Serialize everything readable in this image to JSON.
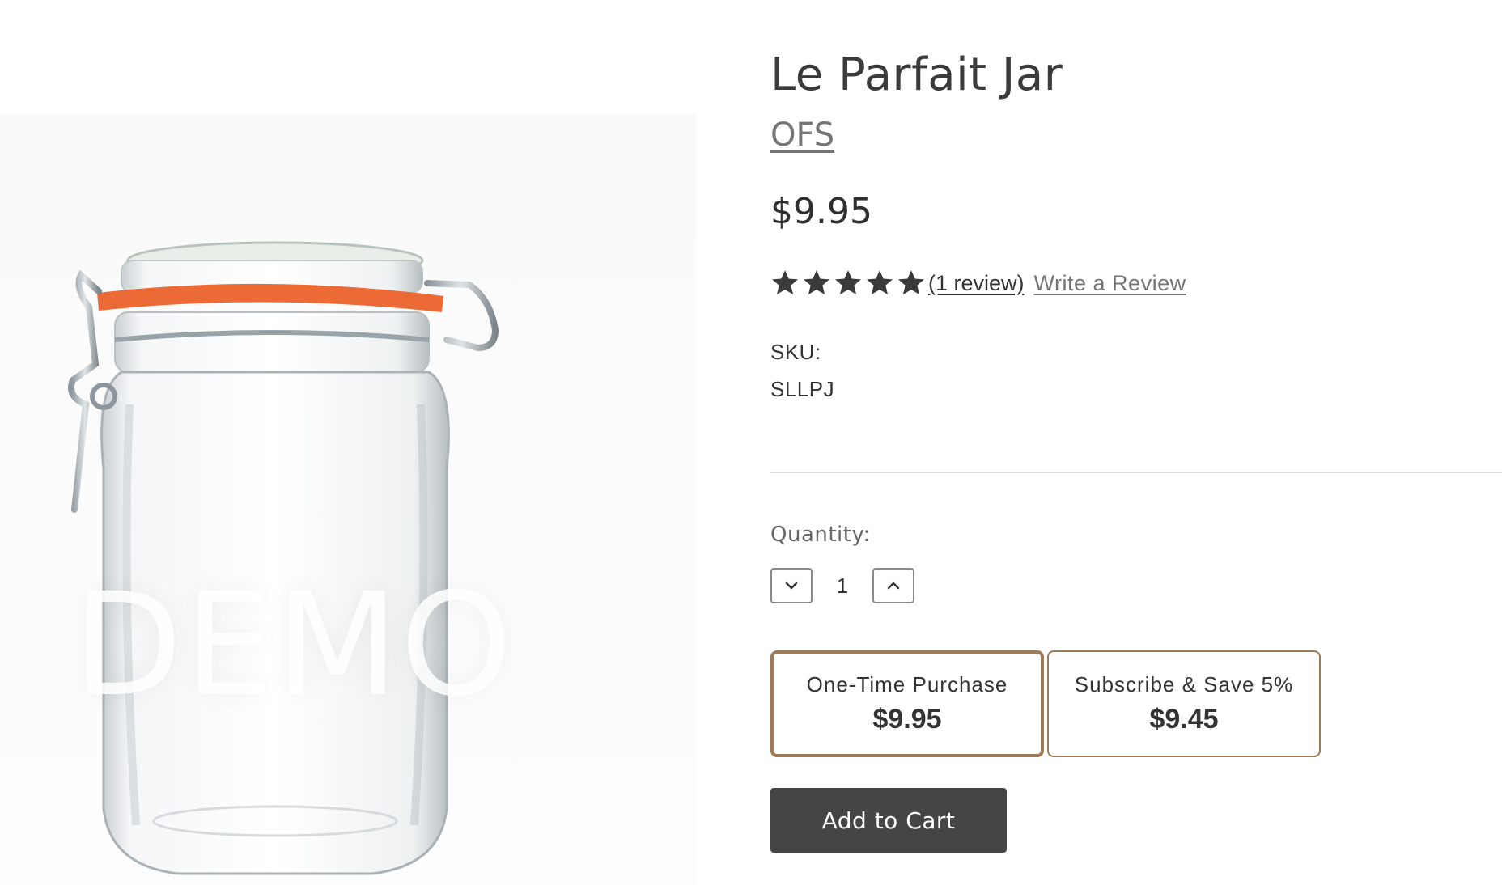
{
  "product": {
    "title": "Le Parfait Jar",
    "brand": "OFS",
    "price": "$9.95",
    "image_watermark": "DEMO"
  },
  "rating": {
    "stars": 5,
    "max_stars": 5,
    "review_count_label": "(1 review)",
    "write_review_label": "Write a Review",
    "star_icon": "star-icon",
    "star_color": "#3a3a3a"
  },
  "sku": {
    "label": "SKU:",
    "value": "SLLPJ"
  },
  "quantity": {
    "label": "Quantity:",
    "value": "1",
    "decrement_icon": "chevron-down-icon",
    "increment_icon": "chevron-up-icon"
  },
  "purchase_options": [
    {
      "label": "One-Time Purchase",
      "price": "$9.95",
      "selected": true
    },
    {
      "label": "Subscribe & Save 5%",
      "price": "$9.45",
      "selected": false
    }
  ],
  "cart": {
    "add_label": "Add to Cart"
  },
  "colors": {
    "option_border": "#a07a56",
    "button_bg": "#454545",
    "jar_seal": "#ec6a35"
  }
}
